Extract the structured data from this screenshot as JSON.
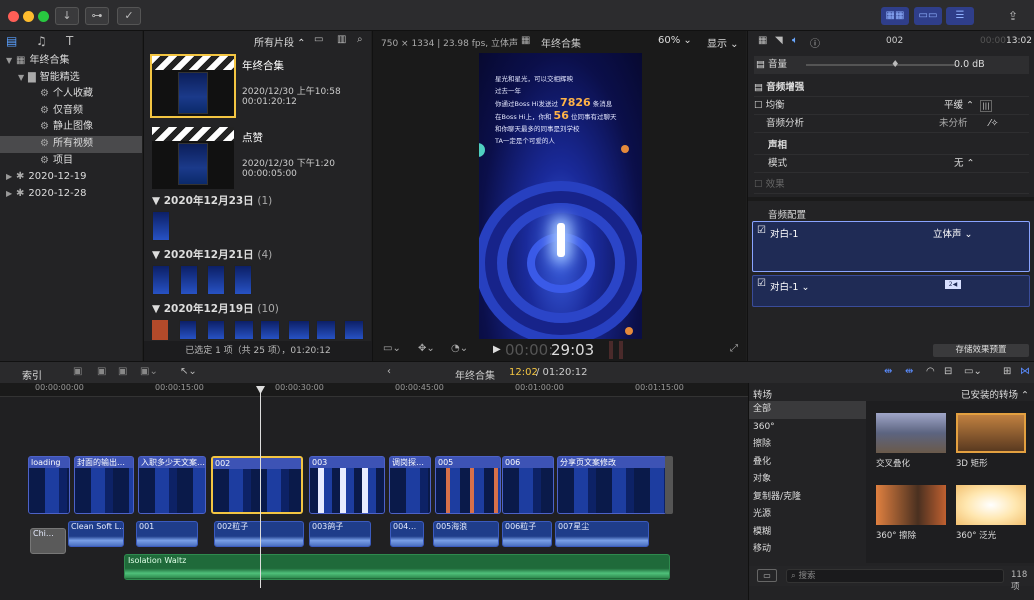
{
  "toolbar": {
    "lib_icons": [
      "import-icon",
      "key-icon",
      "check-icon"
    ]
  },
  "browser_header": {
    "filter_label": "所有片段 ⌃",
    "search_icon": "search-icon"
  },
  "viewer_header": {
    "format": "750 × 1334 | 23.98 fps, 立体声",
    "title": "年终合集",
    "zoom": "60% ⌄",
    "display": "显示 ⌄"
  },
  "inspector_header": {
    "clip_name": "002",
    "time": "13:02",
    "time_dim": "00:00"
  },
  "library": {
    "items": [
      {
        "label": "年终合集",
        "indent": 0,
        "tri": "▼",
        "icon": "▦"
      },
      {
        "label": "智能精选",
        "indent": 1,
        "tri": "▼",
        "icon": "▇"
      },
      {
        "label": "个人收藏",
        "indent": 2,
        "tri": "",
        "icon": "⚙"
      },
      {
        "label": "仅音频",
        "indent": 2,
        "tri": "",
        "icon": "⚙"
      },
      {
        "label": "静止图像",
        "indent": 2,
        "tri": "",
        "icon": "⚙"
      },
      {
        "label": "所有视频",
        "indent": 2,
        "tri": "",
        "icon": "⚙",
        "selected": true
      },
      {
        "label": "项目",
        "indent": 2,
        "tri": "",
        "icon": "⚙"
      },
      {
        "label": "2020-12-19",
        "indent": 0,
        "tri": "▶",
        "icon": "✱"
      },
      {
        "label": "2020-12-28",
        "indent": 0,
        "tri": "▶",
        "icon": "✱"
      }
    ]
  },
  "browser": {
    "projects": [
      {
        "title": "年终合集",
        "date": "2020/12/30 上午10:58",
        "duration": "00:01:20:12"
      },
      {
        "title": "点赞",
        "date": "2020/12/30 下午1:20",
        "duration": "00:00:05:00"
      }
    ],
    "groups": [
      {
        "label": "2020年12月23日",
        "count": "(1)"
      },
      {
        "label": "2020年12月21日",
        "count": "(4)"
      },
      {
        "label": "2020年12月19日",
        "count": "(10)"
      }
    ],
    "status": "已选定 1 项（共 25 项），01:20:12"
  },
  "viewer": {
    "poster_lines": [
      "星光和星光，可以交相辉映",
      "过去一年",
      "你通过Boss Hi发送过",
      "条消息",
      "在Boss Hi上，你和",
      "位同事有过聊天",
      "和你聊天最多的同事是刘学校",
      "TA一定是个可爱的人"
    ],
    "num1": "7826",
    "num2": "56",
    "timecode_dim": "00:00:",
    "timecode": "29:03"
  },
  "inspector": {
    "volume_label": "音量",
    "volume_value": "0.0 dB",
    "enhance_label": "音频增强",
    "eq_label": "均衡",
    "eq_value": "平缓 ⌃",
    "analysis_label": "音频分析",
    "analysis_value": "未分析",
    "pan_label": "声相",
    "mode_label": "模式",
    "mode_value": "无 ⌃",
    "effects_label": "效果",
    "config_label": "音频配置",
    "config1_label": "对白-1",
    "config1_value": "立体声 ⌄",
    "config2_label": "对白-1 ⌄",
    "save_preset": "存储效果预置"
  },
  "timeline_header": {
    "index": "索引",
    "project": "年终合集",
    "time_current": "12:02",
    "time_total": "/ 01:20:12"
  },
  "ruler": [
    "00:00:00:00",
    "00:00:15:00",
    "00:00:30:00",
    "00:00:45:00",
    "00:01:00:00",
    "00:01:15:00"
  ],
  "clips": [
    "loading",
    "封面的输出…",
    "入职多少天文案…",
    "002",
    "003",
    "调岗探…",
    "005",
    "006",
    "分享页文案修改"
  ],
  "audio_clips": [
    "Chi…",
    "Clean Soft L…",
    "001",
    "002粒子",
    "003鸽子",
    "004…",
    "005海浪",
    "006粒子",
    "007星尘"
  ],
  "music": "Isolation Waltz",
  "transitions": {
    "header": "转场",
    "installed": "已安装的转场 ⌃",
    "categories": [
      "全部",
      "360°",
      "擦除",
      "叠化",
      "对象",
      "复制器/克隆",
      "光源",
      "模糊",
      "移动"
    ],
    "items": [
      "交叉叠化",
      "3D 矩形",
      "360° 擦除",
      "360° 泛光"
    ],
    "search_placeholder": "搜索",
    "count": "118 项"
  }
}
